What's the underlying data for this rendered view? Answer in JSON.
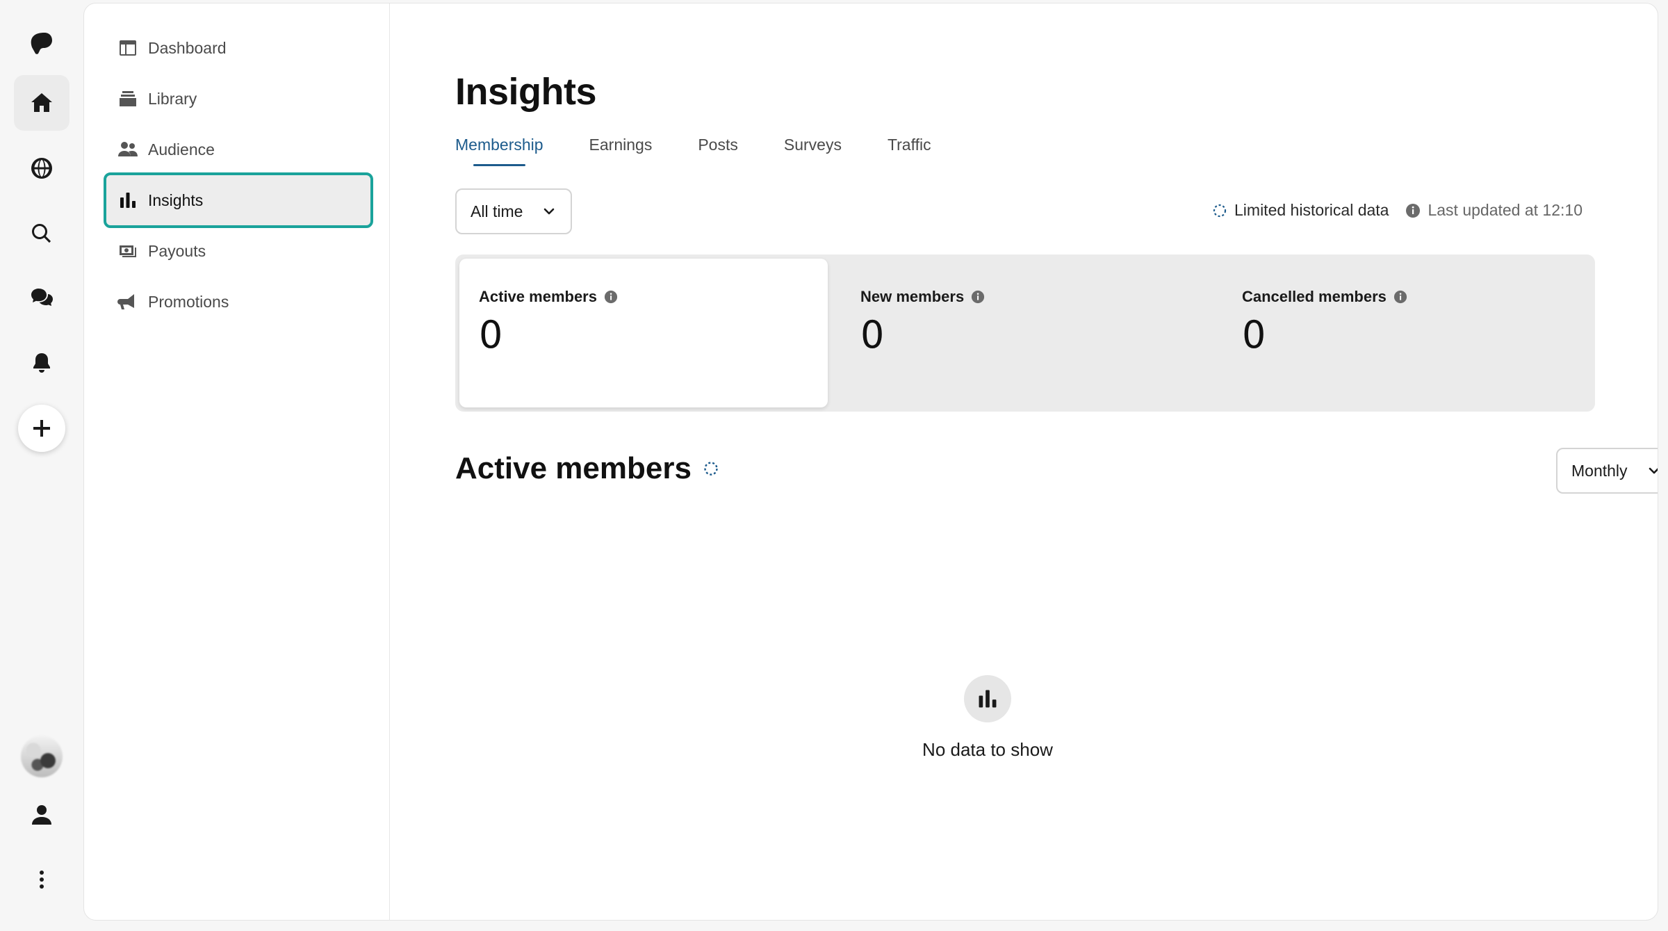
{
  "rail": {
    "items": [
      "logo-icon",
      "home-icon",
      "globe-icon",
      "search-icon",
      "chat-icon",
      "bell-icon",
      "plus-icon",
      "avatar",
      "user-icon",
      "more-icon"
    ]
  },
  "sidebar": {
    "items": [
      {
        "label": "Dashboard",
        "icon": "dashboard-icon"
      },
      {
        "label": "Library",
        "icon": "library-icon"
      },
      {
        "label": "Audience",
        "icon": "audience-icon"
      },
      {
        "label": "Insights",
        "icon": "insights-icon",
        "active": true
      },
      {
        "label": "Payouts",
        "icon": "payouts-icon"
      },
      {
        "label": "Promotions",
        "icon": "megaphone-icon"
      }
    ]
  },
  "page": {
    "title": "Insights",
    "tabs": [
      "Membership",
      "Earnings",
      "Posts",
      "Surveys",
      "Traffic"
    ],
    "active_tab": "Membership",
    "time_filter": "All time",
    "limited_text": "Limited historical data",
    "updated_text": "Last updated at 12:10"
  },
  "metrics": [
    {
      "label": "Active members",
      "value": "0"
    },
    {
      "label": "New members",
      "value": "0"
    },
    {
      "label": "Cancelled members",
      "value": "0"
    }
  ],
  "chart_section": {
    "title": "Active members",
    "interval": "Monthly",
    "empty_text": "No data to show"
  },
  "colors": {
    "accent": "#1d5b8c",
    "highlight_outline": "#1aa39b"
  }
}
